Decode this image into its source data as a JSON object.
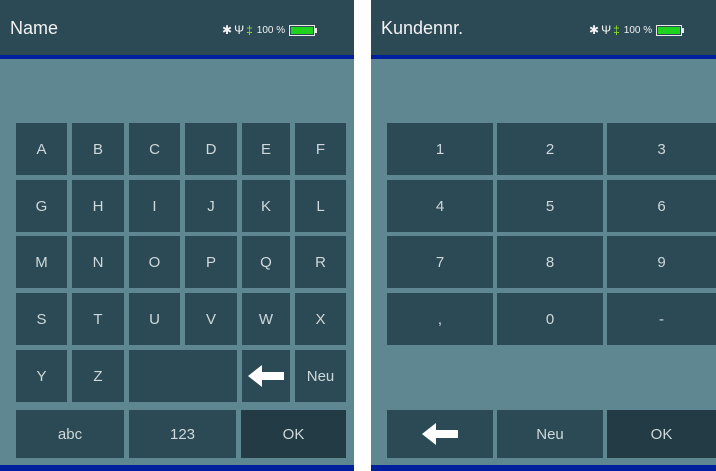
{
  "left_screen": {
    "title": "Name",
    "status": {
      "battery_text": "100 %",
      "bluetooth_icon": "✱",
      "usb_icon": "Ψ",
      "plug_icon": "‡",
      "battery_level": 1.0
    },
    "letter_keys": [
      "A",
      "B",
      "C",
      "D",
      "E",
      "F",
      "G",
      "H",
      "I",
      "J",
      "K",
      "L",
      "M",
      "N",
      "O",
      "P",
      "Q",
      "R",
      "S",
      "T",
      "U",
      "V",
      "W",
      "X",
      "Y",
      "Z"
    ],
    "backspace_icon": "arrow-left-icon",
    "new_key": "Neu",
    "mode_abc": "abc",
    "mode_123": "123",
    "ok": "OK"
  },
  "right_screen": {
    "title": "Kundennr.",
    "status": {
      "battery_text": "100 %",
      "bluetooth_icon": "✱",
      "usb_icon": "Ψ",
      "plug_icon": "‡",
      "battery_level": 1.0
    },
    "keys": [
      "1",
      "2",
      "3",
      "4",
      "5",
      "6",
      "7",
      "8",
      "9",
      ",",
      "0",
      "-"
    ],
    "backspace_icon": "arrow-left-icon",
    "new_key": "Neu",
    "ok": "OK"
  },
  "colors": {
    "screen_bg": "#5e8791",
    "key_bg": "#2c4a55",
    "ok_bg": "#233b44",
    "accent_line": "#001f9c",
    "battery_green": "#1ed21e"
  }
}
